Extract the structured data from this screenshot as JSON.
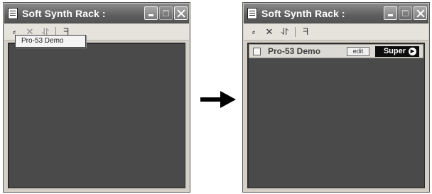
{
  "windows": {
    "left": {
      "title": "Soft Synth Rack :",
      "toolbar": {
        "add": "⸗",
        "remove": "✕",
        "sort": "⥯",
        "tune": "ᖷ"
      },
      "popup_item": "Pro-53 Demo"
    },
    "right": {
      "title": "Soft Synth Rack :",
      "toolbar": {
        "add": "⸗",
        "remove": "✕",
        "sort": "⥯",
        "tune": "ᖷ"
      },
      "rack_row": {
        "instrument_name": "Pro-53 Demo",
        "edit_label": "edit",
        "preset_label": "Super",
        "preset_arrow": "▶"
      }
    }
  },
  "icons": {
    "app": "synth-rack-icon",
    "minimize": "minimize-icon",
    "maximize": "maximize-icon",
    "close": "close-icon",
    "transition": "arrow-right-icon"
  },
  "colors": {
    "titlebar": "#5e5e5e",
    "panel": "#4a4a4a",
    "preset_bg": "#0c0c0c"
  }
}
